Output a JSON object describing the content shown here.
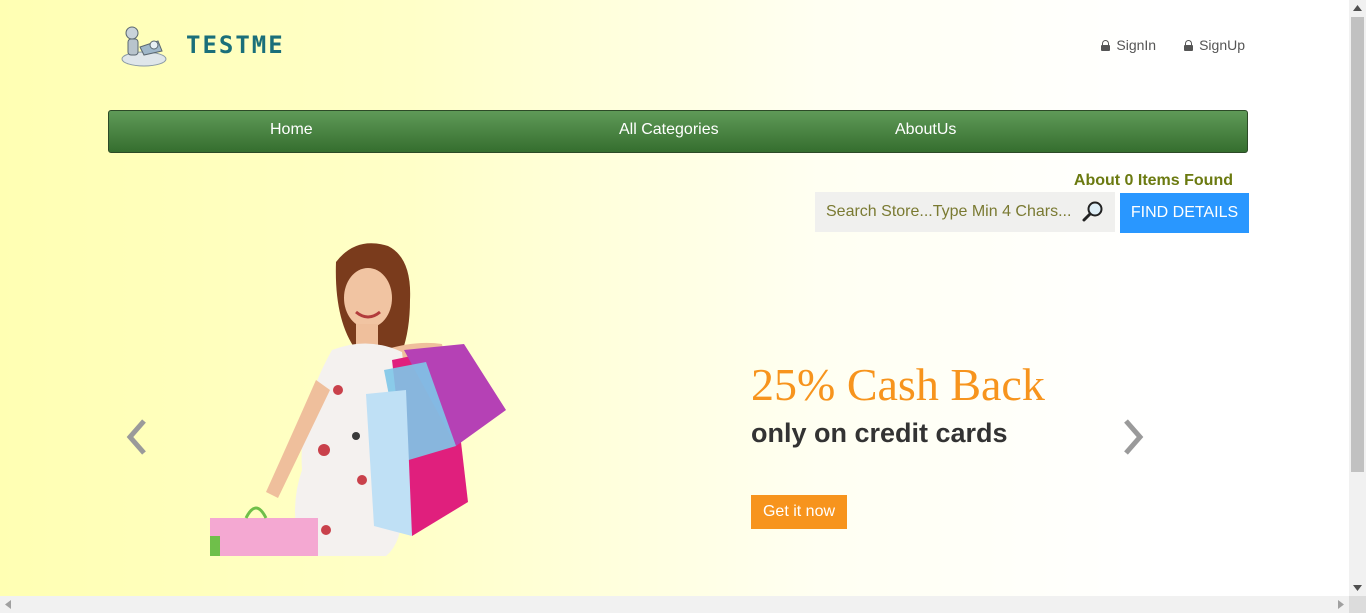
{
  "header": {
    "logo_text": "TESTME",
    "auth": {
      "signin_label": "SignIn",
      "signup_label": "SignUp"
    }
  },
  "nav": {
    "items": [
      "Home",
      "All Categories",
      "AboutUs"
    ]
  },
  "search": {
    "items_found": "About 0 Items Found",
    "placeholder": "Search Store...Type Min 4 Chars...",
    "button_label": "FIND DETAILS"
  },
  "carousel": {
    "headline": "25% Cash Back",
    "subline": "only on credit cards",
    "cta_label": "Get it now"
  },
  "colors": {
    "accent_orange": "#f7941d",
    "nav_green": "#356e2f",
    "button_blue": "#2997ff",
    "logo_teal": "#1a6f7a"
  },
  "icons": [
    "lock-icon",
    "search-icon",
    "chevron-left-icon",
    "chevron-right-icon",
    "logo-icon"
  ]
}
